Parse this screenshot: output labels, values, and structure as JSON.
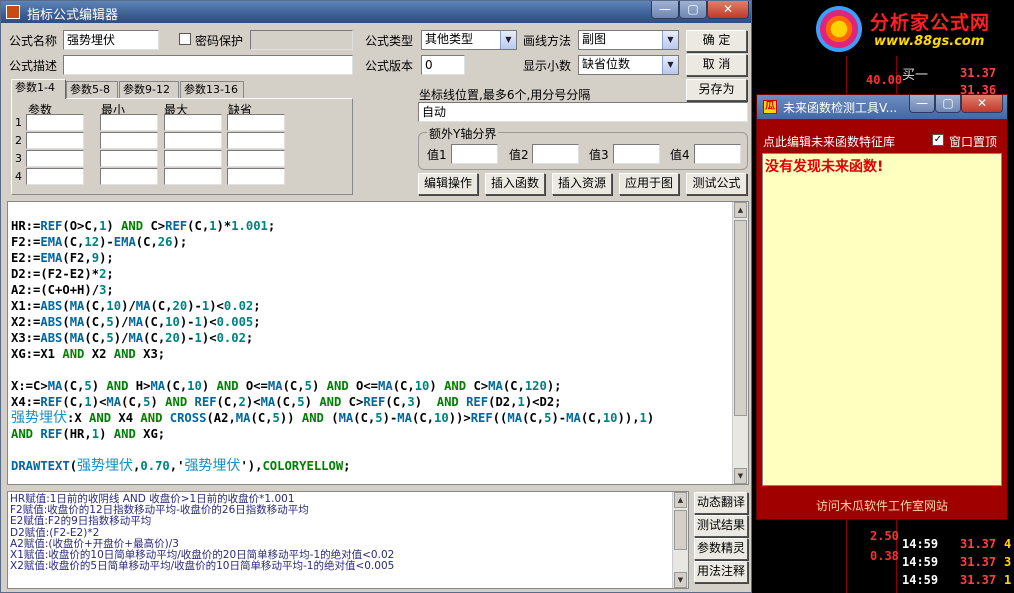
{
  "editor": {
    "title": "指标公式编辑器",
    "window_buttons": [
      "—",
      "▢",
      "✕"
    ],
    "formula_name_label": "公式名称",
    "formula_name_value": "强势埋伏",
    "password_label": "密码保护",
    "password_checked": false,
    "formula_desc_label": "公式描述",
    "formula_desc_value": "",
    "formula_type_label": "公式类型",
    "formula_type_value": "其他类型",
    "draw_method_label": "画线方法",
    "draw_method_value": "副图",
    "formula_version_label": "公式版本",
    "formula_version_value": "0",
    "decimal_label": "显示小数",
    "decimal_value": "缺省位数",
    "buttons": {
      "ok": "确  定",
      "cancel": "取  消",
      "save_as": "另存为",
      "edit_op": "编辑操作",
      "insert_func": "插入函数",
      "insert_res": "插入资源",
      "apply_chart": "应用于图",
      "test_formula": "测试公式"
    },
    "tabs": [
      "参数1-4",
      "参数5-8",
      "参数9-12",
      "参数13-16"
    ],
    "param_headers": [
      "参数",
      "最小",
      "最大",
      "缺省"
    ],
    "param_rows": [
      "1",
      "2",
      "3",
      "4"
    ],
    "axis_label": "坐标线位置,最多6个,用分号分隔",
    "axis_value": "自动",
    "extra_y_title": "额外Y轴分界",
    "extra_y_labels": [
      "值1",
      "值2",
      "值3",
      "值4"
    ]
  },
  "code_lines": [
    "HR:=REF(O>C,1) AND C>REF(C,1)*1.001;",
    "F2:=EMA(C,12)-EMA(C,26);",
    "E2:=EMA(F2,9);",
    "D2:=(F2-E2)*2;",
    "A2:=(C+O+H)/3;",
    "X1:=ABS(MA(C,10)/MA(C,20)-1)<0.02;",
    "X2:=ABS(MA(C,5)/MA(C,10)-1)<0.005;",
    "X3:=ABS(MA(C,5)/MA(C,20)-1)<0.02;",
    "XG:=X1 AND X2 AND X3;",
    "",
    "X:=C>MA(C,5) AND H>MA(C,10) AND O<=MA(C,5) AND O<=MA(C,10) AND C>MA(C,120);",
    "X4:=REF(C,1)<MA(C,5) AND REF(C,2)<MA(C,5) AND C>REF(C,3)  AND REF(D2,1)<D2;",
    "强势埋伏:X AND X4 AND CROSS(A2,MA(C,5)) AND (MA(C,5)-MA(C,10))>REF((MA(C,5)-MA(C,10)),1)",
    "AND REF(HR,1) AND XG;",
    "",
    "DRAWTEXT(强势埋伏,0.70,'强势埋伏'),COLORYELLOW;"
  ],
  "explain_lines": [
    "HR赋值:1日前的收阴线 AND 收盘价>1日前的收盘价*1.001",
    "F2赋值:收盘价的12日指数移动平均-收盘价的26日指数移动平均",
    "E2赋值:F2的9日指数移动平均",
    "D2赋值:(F2-E2)*2",
    "A2赋值:(收盘价+开盘价+最高价)/3",
    "X1赋值:收盘价的10日简单移动平均/收盘价的20日简单移动平均-1的绝对值<0.02",
    "X2赋值:收盘价的5日简单移动平均/收盘价的10日简单移动平均-1的绝对值<0.005"
  ],
  "side_buttons": [
    "动态翻译",
    "测试结果",
    "参数精灵",
    "用法注释"
  ],
  "detector": {
    "title": "未来函数检测工具V...",
    "edit_link": "点此编辑未来函数特征库",
    "topmost_label": "窗口置顶",
    "topmost_checked": true,
    "result": "没有发现未来函数!",
    "footer": "访问木瓜软件工作室网站"
  },
  "background": {
    "logo_name": "分析家公式网",
    "logo_url": "www.88gs.com",
    "price_label": "40.00",
    "buy1_label": "买一",
    "buy1_price": "31.37",
    "buy2_price": "31.36",
    "row_2_50": "2.50",
    "row_0_38": "0.38",
    "times": [
      "14:59",
      "14:59",
      "14:59"
    ],
    "prices": [
      "31.37",
      "31.37",
      "31.37"
    ],
    "vols": [
      "4",
      "3",
      "1"
    ]
  },
  "colors": {
    "keyword": "#008000",
    "function": "#0068a0",
    "number": "#008080",
    "result_red": "#e00000",
    "detector_bg": "#a00000"
  }
}
